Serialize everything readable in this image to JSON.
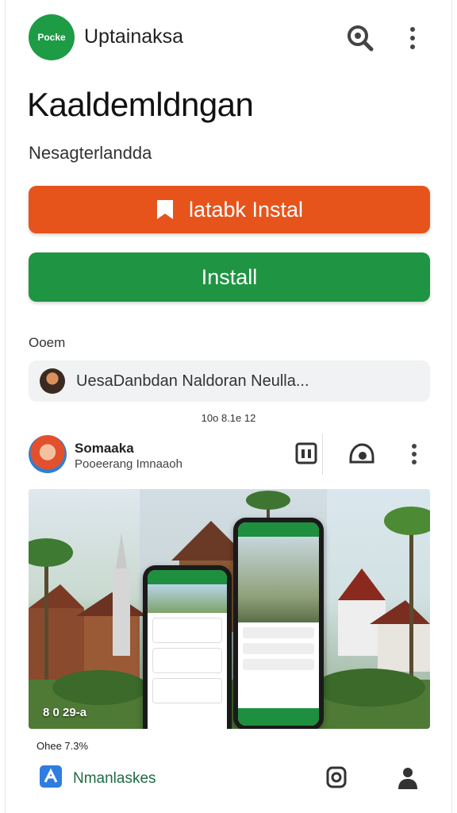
{
  "header": {
    "logo_text": "Pocke",
    "app_name": "Uptainaksa",
    "search_icon": "search-icon",
    "more_icon": "more-vertical-icon"
  },
  "hero": {
    "title": "Kaaldemldngan",
    "subtitle": "Nesagterlandda"
  },
  "buttons": {
    "primary_label": "latabk Instal",
    "primary_icon": "flag-icon",
    "install_label": "Install"
  },
  "section": {
    "label": "Ooem"
  },
  "search": {
    "value": "UesaDanbdan Naldoran Neulla..."
  },
  "meta": {
    "text": "10o 8.1e 12"
  },
  "card": {
    "title": "Somaaka",
    "subtitle": "Pooeerang Imnaaoh",
    "overlay_text": "8 0  29-a",
    "stats_text": "Ohee  7.3%"
  },
  "bottom": {
    "label": "Nmanlaskes"
  },
  "colors": {
    "orange": "#e6541c",
    "green": "#1f9443",
    "brand_green": "#1e9b45"
  }
}
